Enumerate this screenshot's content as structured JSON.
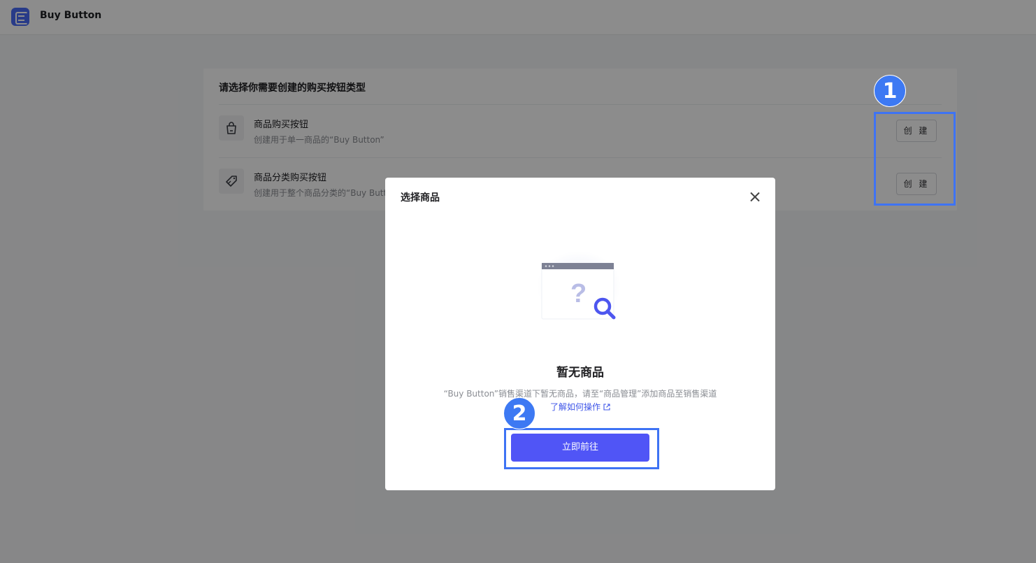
{
  "app": {
    "title": "Buy Button"
  },
  "panel": {
    "title": "请选择你需要创建的购买按钮类型",
    "rows": [
      {
        "title": "商品购买按钮",
        "desc": "创建用于单一商品的“Buy Button”",
        "button": "创 建",
        "icon": "shopping-bag-icon"
      },
      {
        "title": "商品分类购买按钮",
        "desc": "创建用于整个商品分类的“Buy Button”",
        "button": "创 建",
        "icon": "tag-icon"
      }
    ]
  },
  "modal": {
    "title": "选择商品",
    "empty_title": "暂无商品",
    "empty_desc": "“Buy Button”销售渠道下暂无商品，请至“商品管理”添加商品至销售渠道",
    "help_link": "了解如何操作",
    "primary_button": "立即前往"
  },
  "annotations": {
    "badge_1": "1",
    "badge_2": "2",
    "color": "#3e73f4"
  },
  "colors": {
    "primary": "#5055f6",
    "link": "#3e55e8"
  }
}
